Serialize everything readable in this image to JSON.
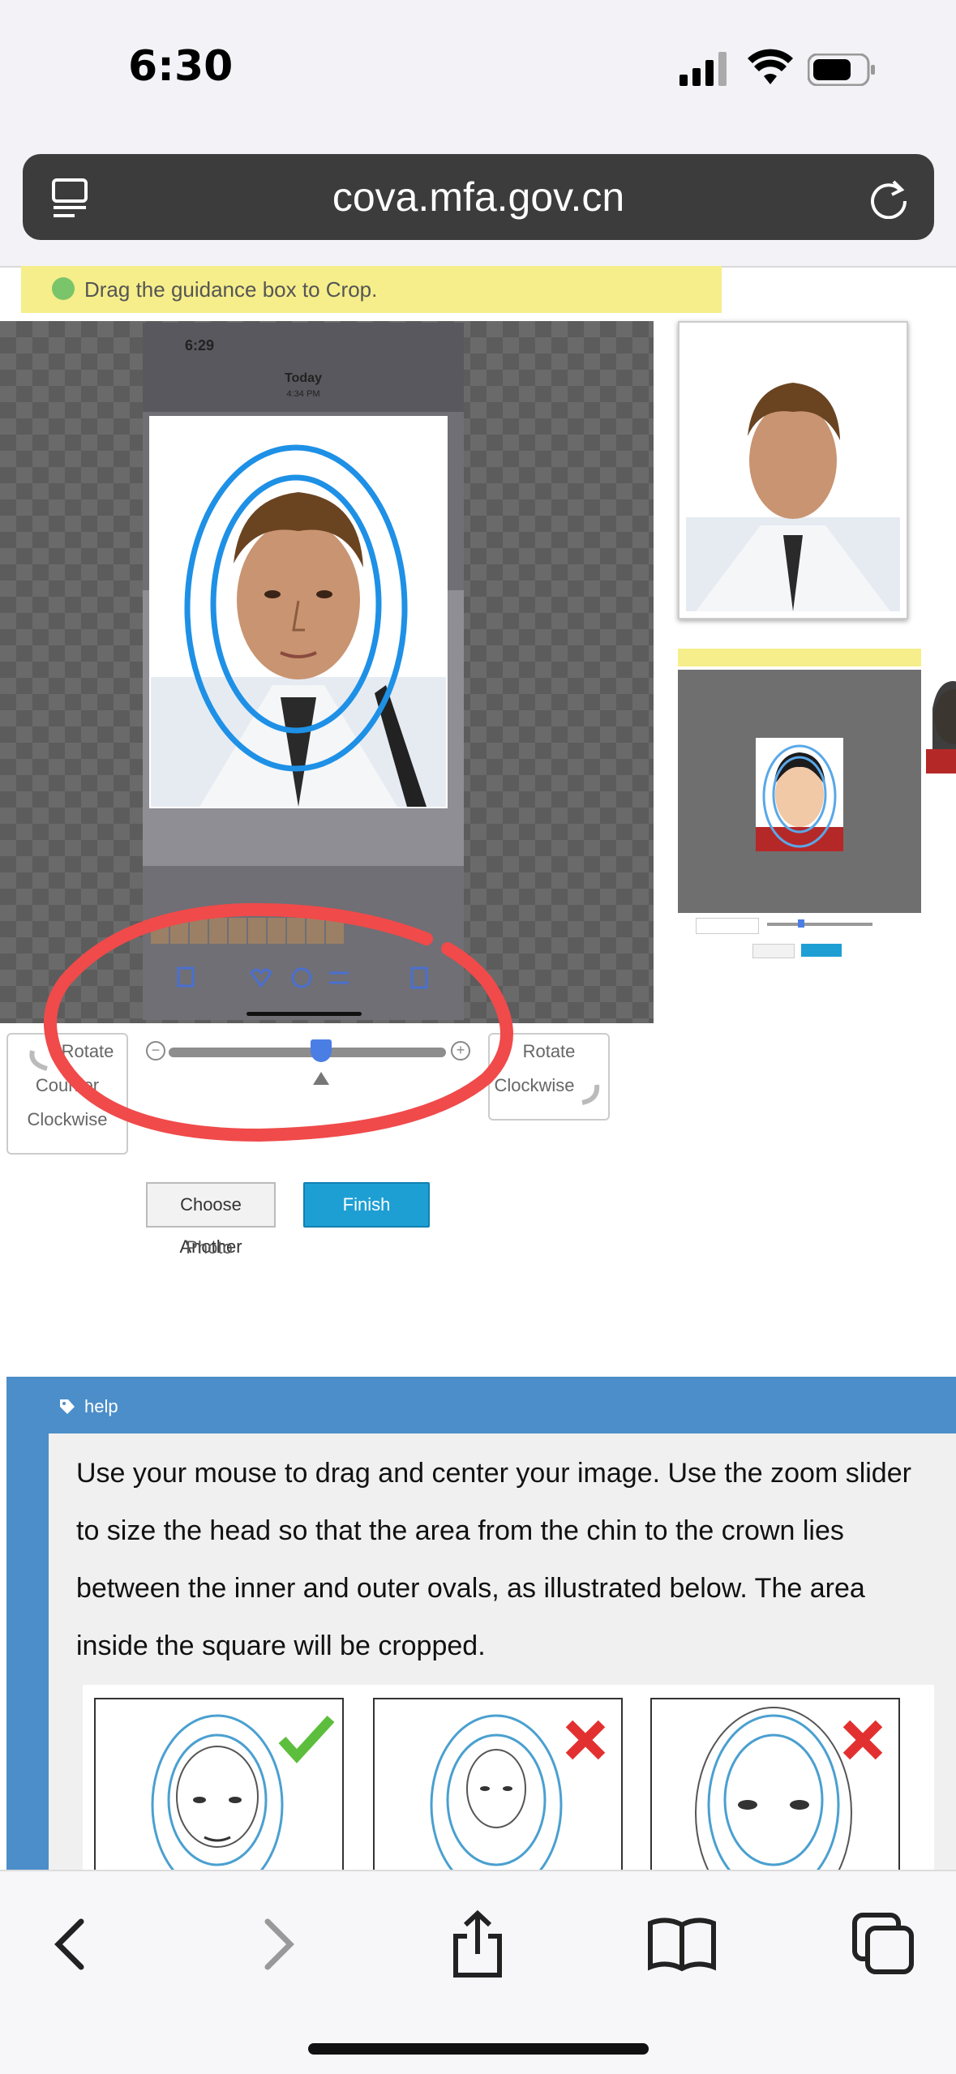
{
  "status_bar": {
    "time": "6:30"
  },
  "browser": {
    "url": "cova.mfa.gov.cn"
  },
  "tip": {
    "text": "Drag the guidance box to Crop."
  },
  "phone_screenshot": {
    "time": "6:29",
    "title": "Today",
    "subtitle": "4:34 PM"
  },
  "controls": {
    "rotate_ccw_line1": "Rotate",
    "rotate_ccw_line2": "Counter",
    "rotate_ccw_line3": "Clockwise",
    "rotate_cw_line1": "Rotate",
    "rotate_cw_line2": "Clockwise",
    "zoom_level_fraction": 0.55
  },
  "buttons": {
    "choose_another_line1": "Choose Another",
    "choose_another_line2": "Photo",
    "finish": "Finish"
  },
  "help": {
    "label": "help",
    "text": "Use your mouse to drag and center your image. Use the zoom slider to size the head so that the area from the chin to the crown lies between the inner and outer ovals, as illustrated below. The area inside the square will be cropped."
  },
  "colors": {
    "accent": "#1e9fd4",
    "help_panel": "#4b8ec9",
    "tip_bg": "#f6ee8a",
    "oval": "#1e90e6",
    "annotation": "#f04a4a"
  },
  "icons": {
    "back": "chevron-left-icon",
    "forward": "chevron-right-icon",
    "share": "share-icon",
    "bookmarks": "book-icon",
    "tabs": "tabs-icon",
    "reload": "reload-icon"
  }
}
